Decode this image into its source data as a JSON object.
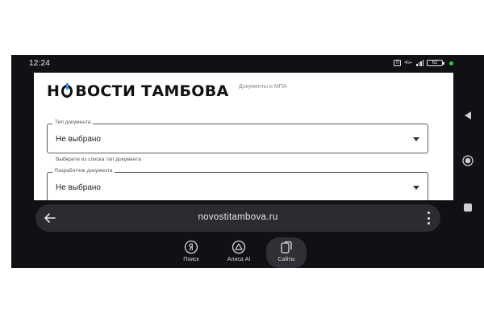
{
  "status_bar": {
    "time": "12:24",
    "nfc_badge": "N",
    "network": "4G+",
    "battery": "62"
  },
  "web": {
    "logo_pre": "Н",
    "logo_post": "ВОСТИ ТАМБОВА",
    "section_label": "Документы и МПА",
    "fields": [
      {
        "legend": "Тип документа",
        "value": "Не выбрано",
        "hint": "Выберите из списка тип документа"
      },
      {
        "legend": "Разработчик документа",
        "value": "Не выбрано"
      }
    ]
  },
  "browser": {
    "url": "novostitambova.ru"
  },
  "bottom_tabs": [
    {
      "label": "Поиск",
      "icon": "yandex-search-icon"
    },
    {
      "label": "Алиса AI",
      "icon": "alice-ai-icon"
    },
    {
      "label": "Сайты",
      "icon": "sites-cards-icon",
      "active": true
    }
  ],
  "nav_icons": [
    "nav-back-triangle-icon",
    "nav-home-circle-icon",
    "nav-recents-square-icon"
  ],
  "colors": {
    "device_bg": "#101114",
    "bar_bg": "#2b2c31",
    "logo_accent": "#2f8de4",
    "status_dot": "#2ecc40"
  }
}
